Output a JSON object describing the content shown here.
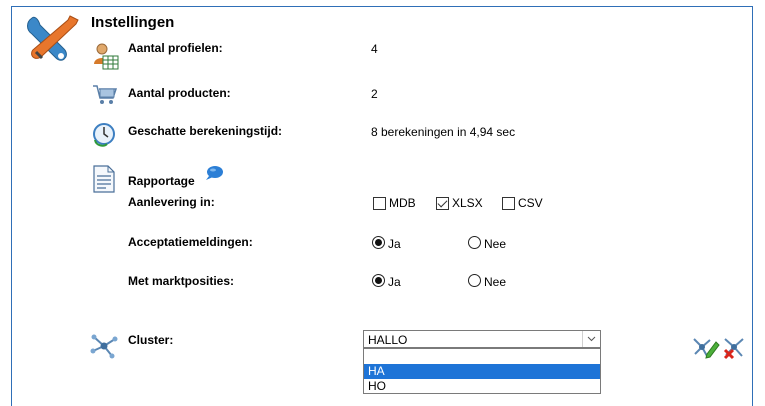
{
  "header": {
    "title": "Instellingen"
  },
  "rows": {
    "profiles": {
      "label": "Aantal profielen:",
      "value": "4"
    },
    "products": {
      "label": "Aantal producten:",
      "value": "2"
    },
    "calc": {
      "label": "Geschatte berekeningstijd:",
      "value": "8 berekeningen in 4,94 sec"
    },
    "report": {
      "label": "Rapportage"
    },
    "delivery": {
      "label": "Aanlevering in:",
      "options": [
        {
          "label": "MDB",
          "checked": false
        },
        {
          "label": "XLSX",
          "checked": true
        },
        {
          "label": "CSV",
          "checked": false
        }
      ]
    },
    "acceptance": {
      "label": "Acceptatiemeldingen:",
      "yes": "Ja",
      "no": "Nee",
      "selected": "Ja"
    },
    "market": {
      "label": "Met marktposities:",
      "yes": "Ja",
      "no": "Nee",
      "selected": "Ja"
    },
    "cluster": {
      "label": "Cluster:",
      "selected": "HALLO",
      "options": [
        "",
        "HA",
        "HO"
      ],
      "highlighted": "HA"
    }
  },
  "icons": {
    "settings": "tools-icon",
    "profiles": "user-table-icon",
    "products": "shopping-cart-icon",
    "calc": "clock-refresh-icon",
    "report": "report-document-icon",
    "info": "speech-bubble-icon",
    "cluster": "cluster-icon",
    "edit_cluster": "edit-cluster-icon",
    "delete_cluster": "delete-cluster-icon"
  },
  "colors": {
    "border": "#2f6fb7",
    "highlight": "#1e74d7"
  }
}
